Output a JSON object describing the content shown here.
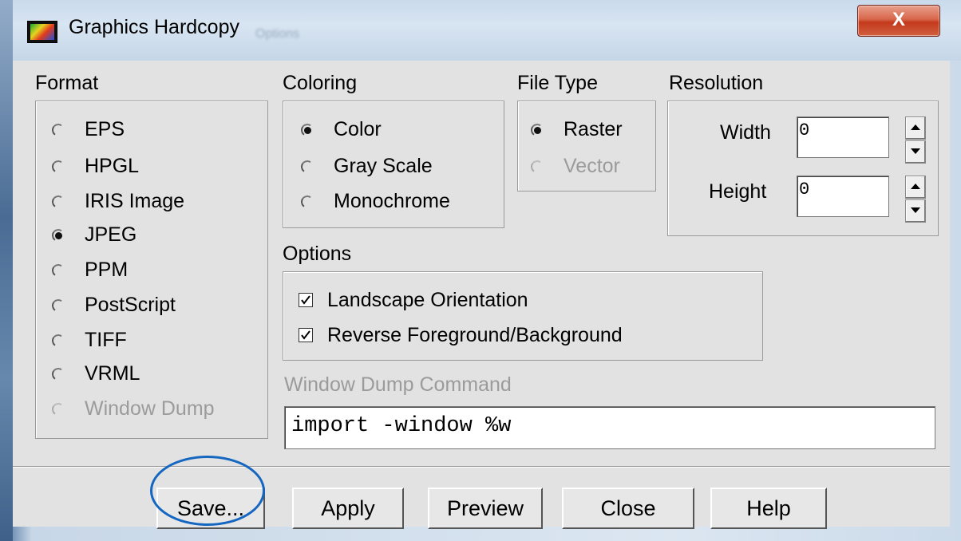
{
  "window": {
    "title": "Graphics Hardcopy",
    "ghost_text": "Options",
    "close_glyph": "X"
  },
  "format": {
    "label": "Format",
    "options": [
      {
        "label": "EPS",
        "selected": false,
        "enabled": true
      },
      {
        "label": "HPGL",
        "selected": false,
        "enabled": true
      },
      {
        "label": "IRIS Image",
        "selected": false,
        "enabled": true
      },
      {
        "label": "JPEG",
        "selected": true,
        "enabled": true
      },
      {
        "label": "PPM",
        "selected": false,
        "enabled": true
      },
      {
        "label": "PostScript",
        "selected": false,
        "enabled": true
      },
      {
        "label": "TIFF",
        "selected": false,
        "enabled": true
      },
      {
        "label": "VRML",
        "selected": false,
        "enabled": true
      },
      {
        "label": "Window Dump",
        "selected": false,
        "enabled": false
      }
    ]
  },
  "coloring": {
    "label": "Coloring",
    "options": [
      {
        "label": "Color",
        "selected": true
      },
      {
        "label": "Gray Scale",
        "selected": false
      },
      {
        "label": "Monochrome",
        "selected": false
      }
    ]
  },
  "file_type": {
    "label": "File Type",
    "options": [
      {
        "label": "Raster",
        "selected": true,
        "enabled": true
      },
      {
        "label": "Vector",
        "selected": false,
        "enabled": false
      }
    ]
  },
  "resolution": {
    "label": "Resolution",
    "width_label": "Width",
    "width_value": "0",
    "height_label": "Height",
    "height_value": "0"
  },
  "options": {
    "label": "Options",
    "landscape_label": "Landscape Orientation",
    "landscape_checked": true,
    "reverse_label": "Reverse Foreground/Background",
    "reverse_checked": true
  },
  "window_dump": {
    "label": "Window Dump Command",
    "value": "import -window %w"
  },
  "buttons": {
    "save": "Save...",
    "apply": "Apply",
    "preview": "Preview",
    "close": "Close",
    "help": "Help"
  },
  "colors": {
    "annotation_circle": "#1466c0",
    "dialog_bg": "#e2e2e2",
    "close_button": "#d0603f"
  }
}
